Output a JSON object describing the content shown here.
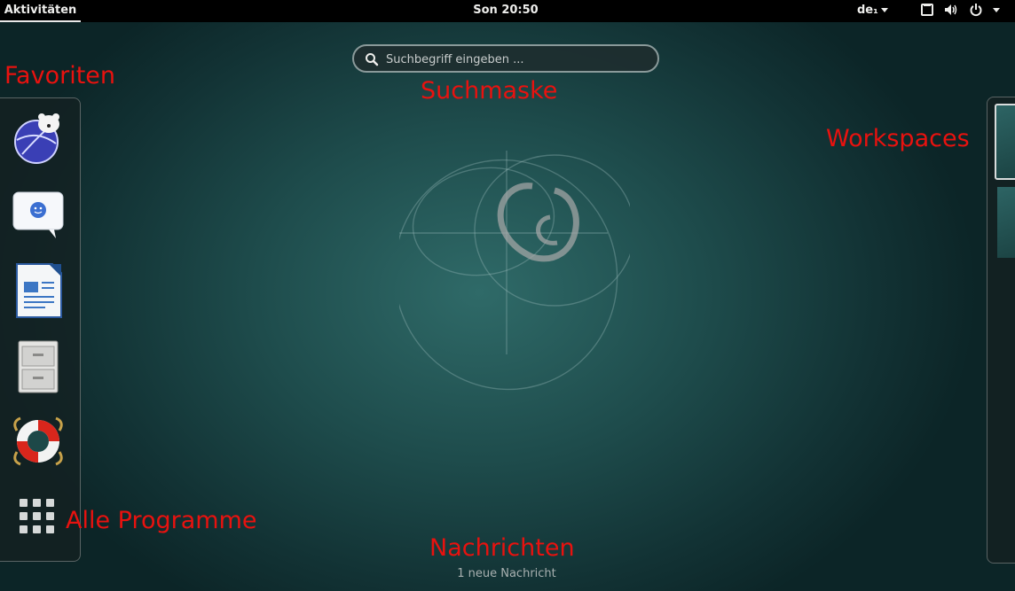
{
  "topbar": {
    "activities": "Aktivitäten",
    "clock": "Son 20:50",
    "keyboard_layout": "de₁"
  },
  "search": {
    "placeholder": "Suchbegriff eingeben ..."
  },
  "dash": {
    "apps": [
      {
        "icon": "iceweasel-browser-icon"
      },
      {
        "icon": "empathy-chat-icon"
      },
      {
        "icon": "libreoffice-writer-icon"
      },
      {
        "icon": "file-cabinet-icon"
      },
      {
        "icon": "help-lifebuoy-icon"
      }
    ],
    "show_apps_icon": "app-grid-icon"
  },
  "annotations": {
    "favoriten": "Favoriten",
    "suchmaske": "Suchmaske",
    "workspaces": "Workspaces",
    "alle_programme": "Alle Programme",
    "nachrichten": "Nachrichten"
  },
  "message_tray": {
    "label": "1 neue Nachricht"
  },
  "colors": {
    "annotation": "#e8120f",
    "topbar": "#000000",
    "background": "#1e4c4c"
  }
}
